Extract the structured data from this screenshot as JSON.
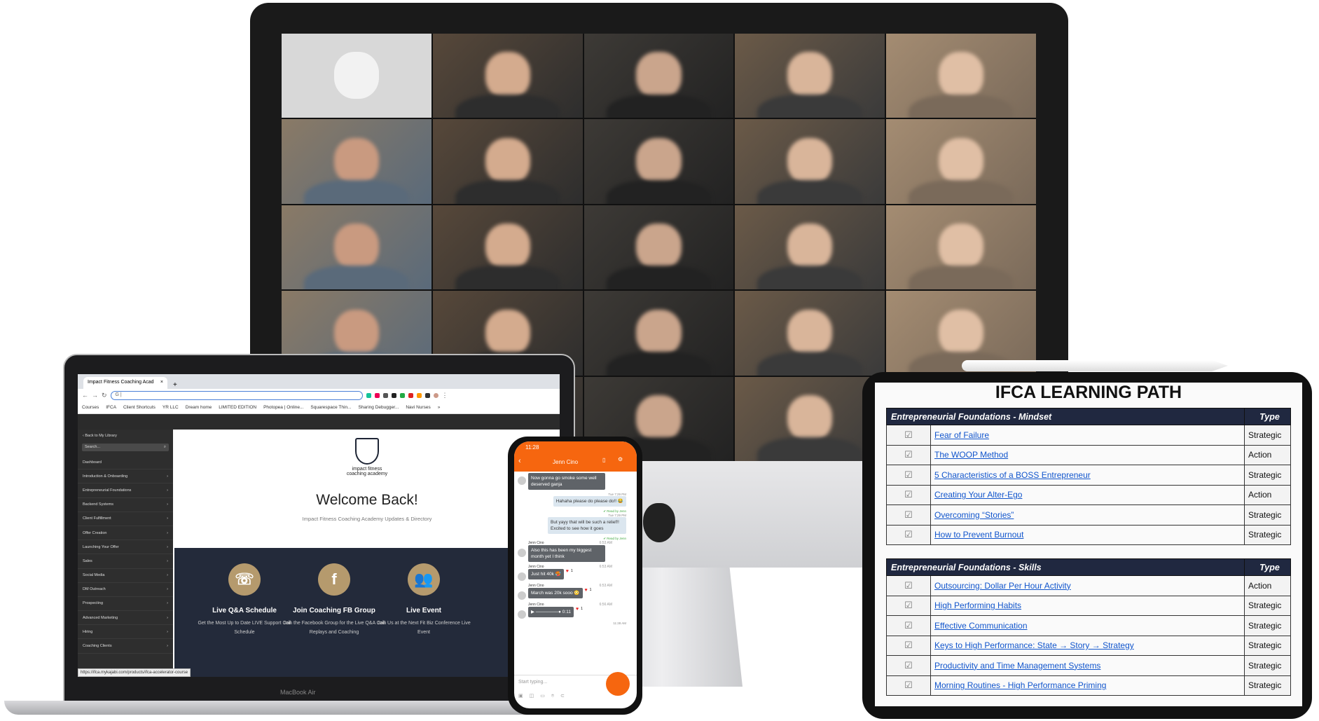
{
  "imac": {
    "tiles": 25
  },
  "laptop": {
    "model_label": "MacBook Air",
    "browser": {
      "tab_title": "Impact Fitness Coaching Acad",
      "tab_close": "×",
      "new_tab": "+",
      "address_value": "",
      "bookmarks": [
        "Courses",
        "IFCA",
        "Client Shortcuts",
        "YR LLC",
        "Dream home",
        "LIMITED EDITION",
        "Photopea | Online...",
        "Squarespace Thin...",
        "Sharing Debugger...",
        "Navi Nurses"
      ],
      "more": "»"
    },
    "sidebar": {
      "back": "‹ Back to My Library",
      "search_placeholder": "Search...",
      "items": [
        "Dashboard",
        "Introduction & Onboarding",
        "Entrepreneurial Foundations",
        "Backend Systems",
        "Client Fulfillment",
        "Offer Creation",
        "Launching Your Offer",
        "Sales",
        "Social Media",
        "DM Outreach",
        "Prospecting",
        "Advanced Marketing",
        "Hiring",
        "Coaching Clients"
      ]
    },
    "main": {
      "logo_text": "impact fitness coaching academy",
      "title": "Welcome Back!",
      "subtitle": "Impact Fitness Coaching Academy Updates & Directory",
      "cards": [
        {
          "title": "Live Q&A Schedule",
          "desc": "Get the Most Up to Date LIVE Support Call Schedule",
          "icon": "calendar-phone-icon"
        },
        {
          "title": "Join Coaching FB Group",
          "desc": "Join the Facebook Group for the Live Q&A Call Replays and Coaching",
          "icon": "facebook-icon"
        },
        {
          "title": "Live Event",
          "desc": "Join Us at the Next Fit Biz Conference Live Event",
          "icon": "group-icon"
        }
      ]
    },
    "status_url": "https://ifca.mykajabi.com/products/ifca-accelerator-course"
  },
  "phone": {
    "time": "11:28",
    "contact": "Jenn Cino",
    "input_placeholder": "Start typing...",
    "messages": [
      {
        "dir": "in",
        "text": "Now gonna go smoke some well deserved ganja"
      },
      {
        "dir": "out",
        "time": "Tue 7:29 PM",
        "text": "Hahaha please do please do!! 😂",
        "read": "✔ Read by Jenn"
      },
      {
        "dir": "out",
        "time": "Tue 7:29 PM",
        "text": "But yayy that will be such a relief!! Excited to see how it goes",
        "read": "✔ Read by Jenn"
      },
      {
        "dir": "in",
        "name": "Jenn Cino",
        "time": "6:53 AM",
        "text": "Also this has been my biggest month yet I think"
      },
      {
        "dir": "in",
        "name": "Jenn Cino",
        "time": "6:53 AM",
        "text": "Just hit 40k 🥵",
        "hearts": "1"
      },
      {
        "dir": "in",
        "name": "Jenn Cino",
        "time": "6:53 AM",
        "text": "March was 20k sooo 😳",
        "hearts": "1"
      },
      {
        "dir": "in",
        "name": "Jenn Cino",
        "time": "6:56 AM",
        "text": "▶ ───────● 0:11",
        "hearts": "1"
      }
    ],
    "last_time": "11:28 AM"
  },
  "tablet": {
    "title": "IFCA LEARNING PATH",
    "type_header": "Type",
    "sections": [
      {
        "header": "Entrepreneurial Foundations - Mindset",
        "rows": [
          {
            "title": "Fear of Failure",
            "type": "Strategic",
            "checked": true
          },
          {
            "title": "The WOOP Method",
            "type": "Action",
            "checked": true
          },
          {
            "title": "5 Characteristics of a BOSS Entrepreneur",
            "type": "Strategic",
            "checked": true
          },
          {
            "title": "Creating Your Alter-Ego",
            "type": "Action",
            "checked": true
          },
          {
            "title": "Overcoming “Stories”",
            "type": "Strategic",
            "checked": true
          },
          {
            "title": "How to Prevent Burnout",
            "type": "Strategic",
            "checked": true
          }
        ]
      },
      {
        "header": "Entrepreneurial Foundations - Skills",
        "rows": [
          {
            "title": "Outsourcing: Dollar Per Hour Activity",
            "type": "Action",
            "checked": true
          },
          {
            "title": "High Performing Habits",
            "type": "Strategic",
            "checked": true
          },
          {
            "title": "Effective Communication",
            "type": "Strategic",
            "checked": true
          },
          {
            "title": "Keys to High Performance: State → Story → Strategy",
            "type": "Strategic",
            "checked": true
          },
          {
            "title": "Productivity and Time Management Systems",
            "type": "Strategic",
            "checked": true
          },
          {
            "title": "Morning Routines - High Performance Priming",
            "type": "Strategic",
            "checked": true
          }
        ]
      }
    ]
  },
  "colors": {
    "phone_accent": "#f6660f",
    "navy": "#232a3a",
    "gold": "#b59a6d",
    "link": "#1155cc",
    "table_header": "#202840"
  }
}
